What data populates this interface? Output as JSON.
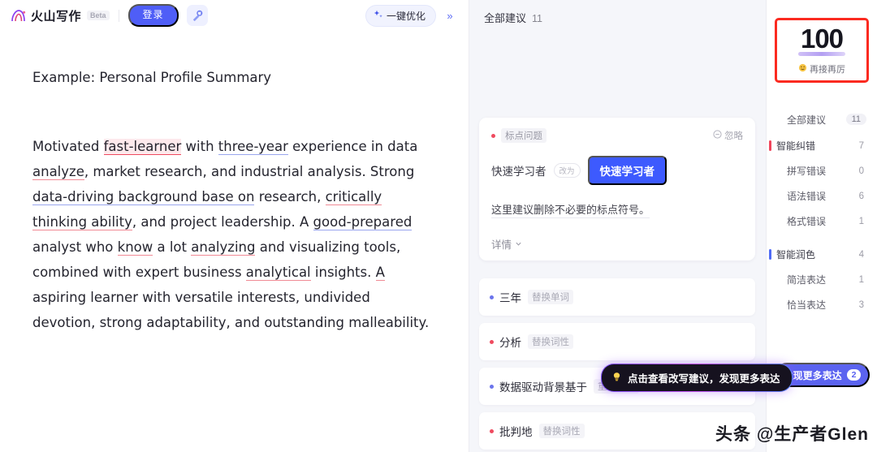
{
  "header": {
    "brand_name": "火山写作",
    "beta_label": "Beta",
    "login_label": "登录",
    "magic_icon": "magic-wand-icon",
    "optimize_label": "一键优化",
    "optimize_icon": "sparkle-icon",
    "collapse_icon": "chevron-double-right-icon"
  },
  "document": {
    "title": "Example: Personal Profile Summary",
    "paragraph": {
      "p1": "Motivated ",
      "err_fast_learner": "fast-learner",
      "p2": " with ",
      "pol_three_year": "three-year",
      "p3": " experience in data ",
      "err_analyze": "analyze",
      "p4": ", market research, and industrial analysis. Strong ",
      "pol_data_driving": "data-driving background base on",
      "p5": " research, ",
      "err_critically": "critically thinking ability",
      "p6": ", and project leadership. A ",
      "pol_good_prepared": "good-prepared",
      "p7": " analyst who ",
      "err_know": "know",
      "p8": " a lot ",
      "err_analyzing": "analyzing",
      "p9": " and visualizing tools, combined with expert business ",
      "err_analytical": "analytical",
      "p10": " insights. ",
      "err_a": "A",
      "p11": " aspiring learner with versatile interests, undivided devotion, strong adaptability, and outstanding malleability."
    }
  },
  "suggestions": {
    "header_label": "全部建议",
    "header_count": "11",
    "card": {
      "dot_color": "#ef4a5f",
      "tag": "标点问题",
      "ignore_label": "忽略",
      "ignore_icon": "minus-circle-icon",
      "original": "快速学习者",
      "arrow_label": "改为",
      "replacement": "快速学习者",
      "description": "这里建议删除不必要的标点符号。",
      "more_label": "详情",
      "more_icon": "chevron-down-icon"
    },
    "items": [
      {
        "word": "三年",
        "op": "替换单词",
        "dot": "blue"
      },
      {
        "word": "分析",
        "op": "替换词性",
        "dot": "red"
      },
      {
        "word": "数据驱动背景基于",
        "op": "重新表述",
        "dot": "blue"
      },
      {
        "word": "批判地",
        "op": "替换词性",
        "dot": "red"
      }
    ],
    "tooltip": {
      "icon": "lightbulb-icon",
      "text": "点击查看改写建议，发现更多表达"
    }
  },
  "rail": {
    "score": "100",
    "score_label": "再接再厉",
    "score_icon": "smile-emoji",
    "score_border_color": "#fb2a20",
    "categories": [
      {
        "label": "全部建议",
        "count": "11",
        "bar": "none",
        "style": "pill",
        "sub": false
      },
      {
        "label": "智能纠错",
        "count": "7",
        "bar": "red",
        "style": "plain",
        "sub": false
      },
      {
        "label": "拼写错误",
        "count": "0",
        "bar": "none",
        "style": "plain",
        "sub": true
      },
      {
        "label": "语法错误",
        "count": "6",
        "bar": "none",
        "style": "plain",
        "sub": true
      },
      {
        "label": "格式错误",
        "count": "1",
        "bar": "none",
        "style": "plain",
        "sub": true
      },
      {
        "label": "智能润色",
        "count": "4",
        "bar": "blue",
        "style": "plain",
        "sub": false
      },
      {
        "label": "简洁表达",
        "count": "1",
        "bar": "none",
        "style": "plain",
        "sub": true
      },
      {
        "label": "恰当表达",
        "count": "3",
        "bar": "none",
        "style": "plain",
        "sub": true
      }
    ],
    "discover_label": "发现更多表达",
    "discover_badge": "2"
  },
  "watermark": "头条 @生产者Glen"
}
